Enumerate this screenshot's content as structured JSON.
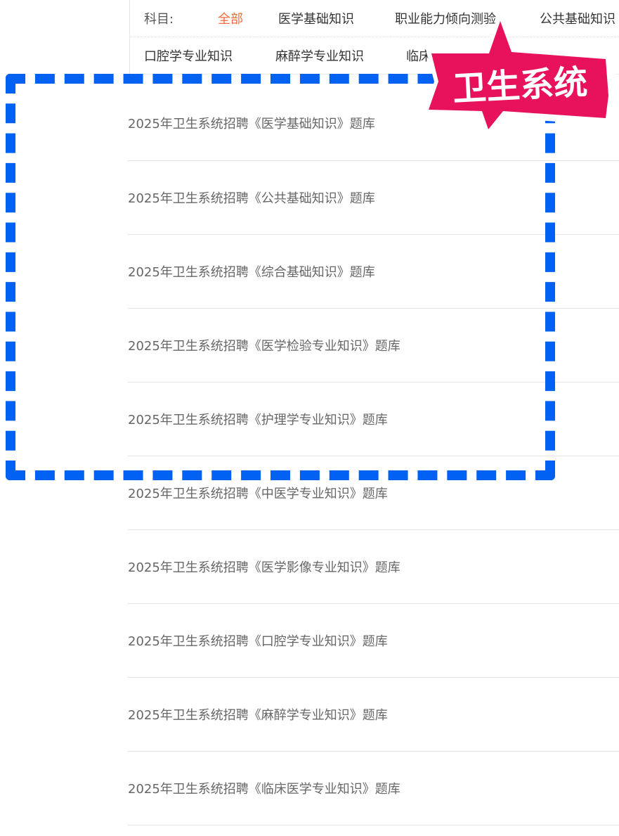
{
  "filter": {
    "label": "科目:",
    "row1": [
      "全部",
      "医学基础知识",
      "职业能力倾向测验",
      "公共基础知识"
    ],
    "row2": [
      "口腔学专业知识",
      "麻醉学专业知识",
      "临床医学专业知识"
    ]
  },
  "question_banks": [
    "2025年卫生系统招聘《医学基础知识》题库",
    "2025年卫生系统招聘《公共基础知识》题库",
    "2025年卫生系统招聘《综合基础知识》题库",
    "2025年卫生系统招聘《医学检验专业知识》题库",
    "2025年卫生系统招聘《护理学专业知识》题库",
    "2025年卫生系统招聘《中医学专业知识》题库",
    "2025年卫生系统招聘《医学影像专业知识》题库",
    "2025年卫生系统招聘《口腔学专业知识》题库",
    "2025年卫生系统招聘《麻醉学专业知识》题库",
    "2025年卫生系统招聘《临床医学专业知识》题库"
  ],
  "badge": {
    "text": "卫生系统"
  },
  "colors": {
    "active_filter": "#f26b3a",
    "highlight_border": "#0061f2",
    "badge": "#e8125c"
  }
}
